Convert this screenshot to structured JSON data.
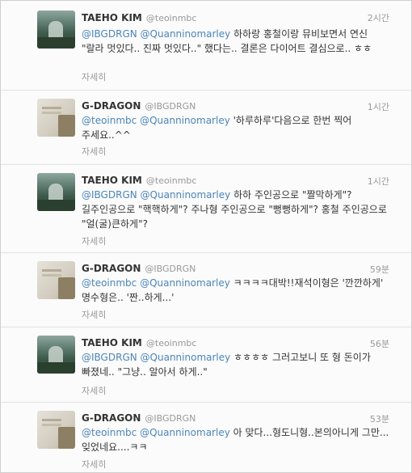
{
  "tweets": [
    {
      "name": "TAEHO KIM",
      "handle": "@teoinmbc",
      "time": "2시간",
      "mentions": [],
      "text": "@IBGDRGN @Quanninomarley 하하랑 홍철이랑 뮤비보면서 연신 \"랄라 멋있다.. 진짜 멋있다..\" 했다는.. 결론은 다이어트 결심으로.. ㅎㅎ",
      "detail": "자세히"
    },
    {
      "name": "G-DRAGON",
      "handle": "@IBGDRGN",
      "time": "1시간",
      "text": "@teoinmbc @Quanninomarley '하루하루'다음으로 한번 찍어 주세요..^^",
      "detail": "자세히"
    },
    {
      "name": "TAEHO KIM",
      "handle": "@teoinmbc",
      "time": "1시간",
      "text": "@IBGDRGN @Quanninomarley 하하 주인공으로 \"짤막하게\"? 길주인공으로 \"핵핵하게\"? 주나형 주인공으로 \"뻥뻥하게\"? 홍철 주인공으로 \"얼(굴)큰하게\"?",
      "detail": "자세히"
    },
    {
      "name": "G-DRAGON",
      "handle": "@IBGDRGN",
      "time": "59분",
      "text": "@teoinmbc @Quanninomarley ㅋㅋㅋㅋ대박!!재석이형은 '깐깐하게' 명수형은.. '짠..하게...'",
      "detail": "자세히"
    },
    {
      "name": "TAEHO KIM",
      "handle": "@teoinmbc",
      "time": "56분",
      "text": "@IBGDRGN @Quanninomarley ㅎㅎㅎㅎ 그러고보니 또 형 돈이가 빠졌네.. \"그냥.. 알아서 하게..\"",
      "detail": "자세히"
    },
    {
      "name": "G-DRAGON",
      "handle": "@IBGDRGN",
      "time": "53분",
      "text": "@teoinmbc @Quanninomarley 아 맞다...형도니형..본의아니게 그만...잊었네요....ㅋㅋ",
      "detail": "자세히"
    }
  ]
}
